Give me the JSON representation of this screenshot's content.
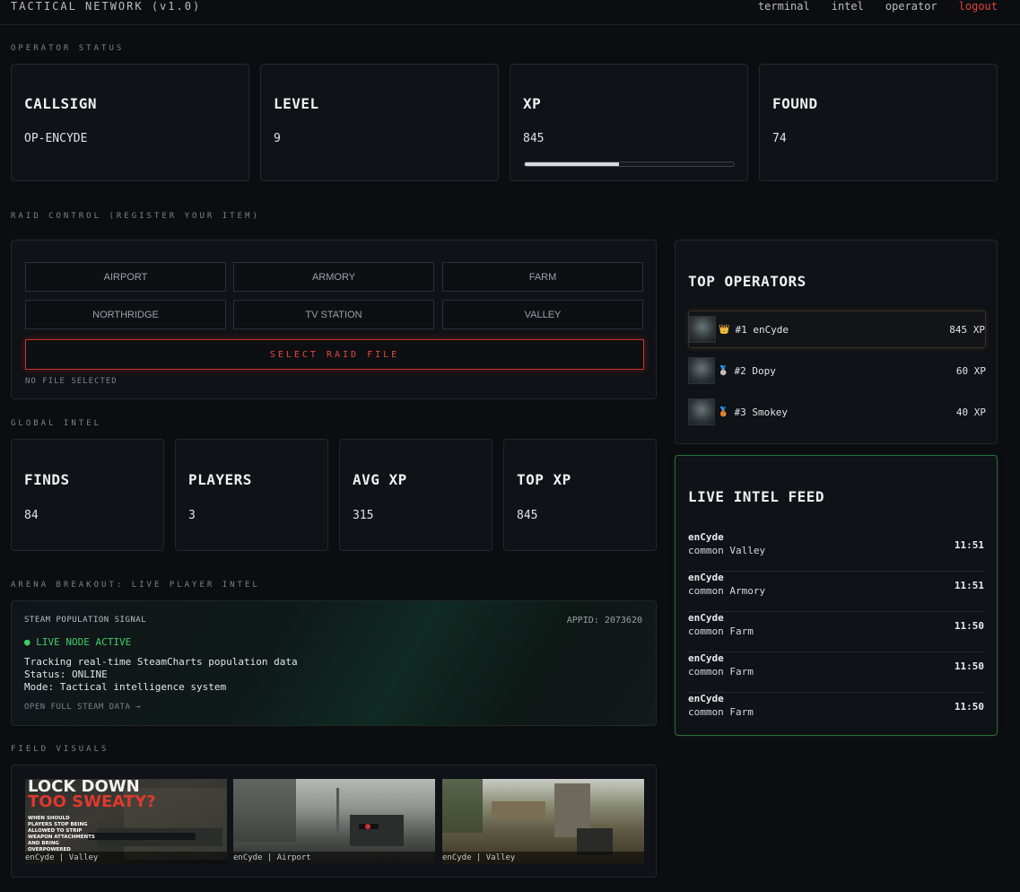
{
  "header": {
    "brand": "TACTICAL NETWORK (v1.0)",
    "nav": [
      "terminal",
      "intel",
      "operator",
      "logout"
    ]
  },
  "operator_status": {
    "label": "OPERATOR STATUS",
    "cards": [
      {
        "title": "CALLSIGN",
        "value": "OP-ENCYDE"
      },
      {
        "title": "LEVEL",
        "value": "9"
      },
      {
        "title": "XP",
        "value": "845",
        "progress_fraction": 0.45
      },
      {
        "title": "FOUND",
        "value": "74"
      }
    ]
  },
  "raid_control": {
    "label": "RAID CONTROL (REGISTER YOUR ITEM)",
    "maps": [
      "AIRPORT",
      "ARMORY",
      "FARM",
      "NORTHRIDGE",
      "TV STATION",
      "VALLEY"
    ],
    "select_label": "SELECT RAID FILE",
    "file_status": "NO FILE SELECTED"
  },
  "global_intel": {
    "label": "GLOBAL INTEL",
    "cards": [
      {
        "title": "FINDS",
        "value": "84"
      },
      {
        "title": "PLAYERS",
        "value": "3"
      },
      {
        "title": "AVG XP",
        "value": "315"
      },
      {
        "title": "TOP XP",
        "value": "845"
      }
    ]
  },
  "arena": {
    "label": "ARENA BREAKOUT: LIVE PLAYER INTEL",
    "heading": "STEAM POPULATION SIGNAL",
    "appid": "APPID: 2073620",
    "live": "● LIVE NODE ACTIVE",
    "line1": "Tracking real-time SteamCharts population data",
    "line2": "Status: ONLINE",
    "line3": "Mode: Tactical intelligence system",
    "link": "OPEN FULL STEAM DATA →"
  },
  "field_visuals": {
    "label": "FIELD VISUALS",
    "items": [
      {
        "caption": "enCyde | Valley",
        "overlay_l1": "LOCK DOWN",
        "overlay_l2": "TOO SWEATY?",
        "overlay_sub": "WHEN SHOULD PLAYERS STOP BEING ALLOWED TO STRIP WEAPON ATTACHMENTS AND BRING OVERPOWERED"
      },
      {
        "caption": "enCyde | Airport"
      },
      {
        "caption": "enCyde | Valley"
      }
    ]
  },
  "top_operators": {
    "title": "TOP OPERATORS",
    "rows": [
      {
        "medal": "👑",
        "name": "#1 enCyde",
        "xp": "845 XP"
      },
      {
        "medal": "🥈",
        "name": "#2 Dopy",
        "xp": "60 XP"
      },
      {
        "medal": "🥉",
        "name": "#3 Smokey",
        "xp": "40 XP"
      }
    ]
  },
  "live_feed": {
    "title": "LIVE INTEL FEED",
    "rows": [
      {
        "user": "enCyde",
        "item": "common Valley",
        "time": "11:51"
      },
      {
        "user": "enCyde",
        "item": "common Armory",
        "time": "11:51"
      },
      {
        "user": "enCyde",
        "item": "common Farm",
        "time": "11:50"
      },
      {
        "user": "enCyde",
        "item": "common Farm",
        "time": "11:50"
      },
      {
        "user": "enCyde",
        "item": "common Farm",
        "time": "11:50"
      }
    ]
  }
}
